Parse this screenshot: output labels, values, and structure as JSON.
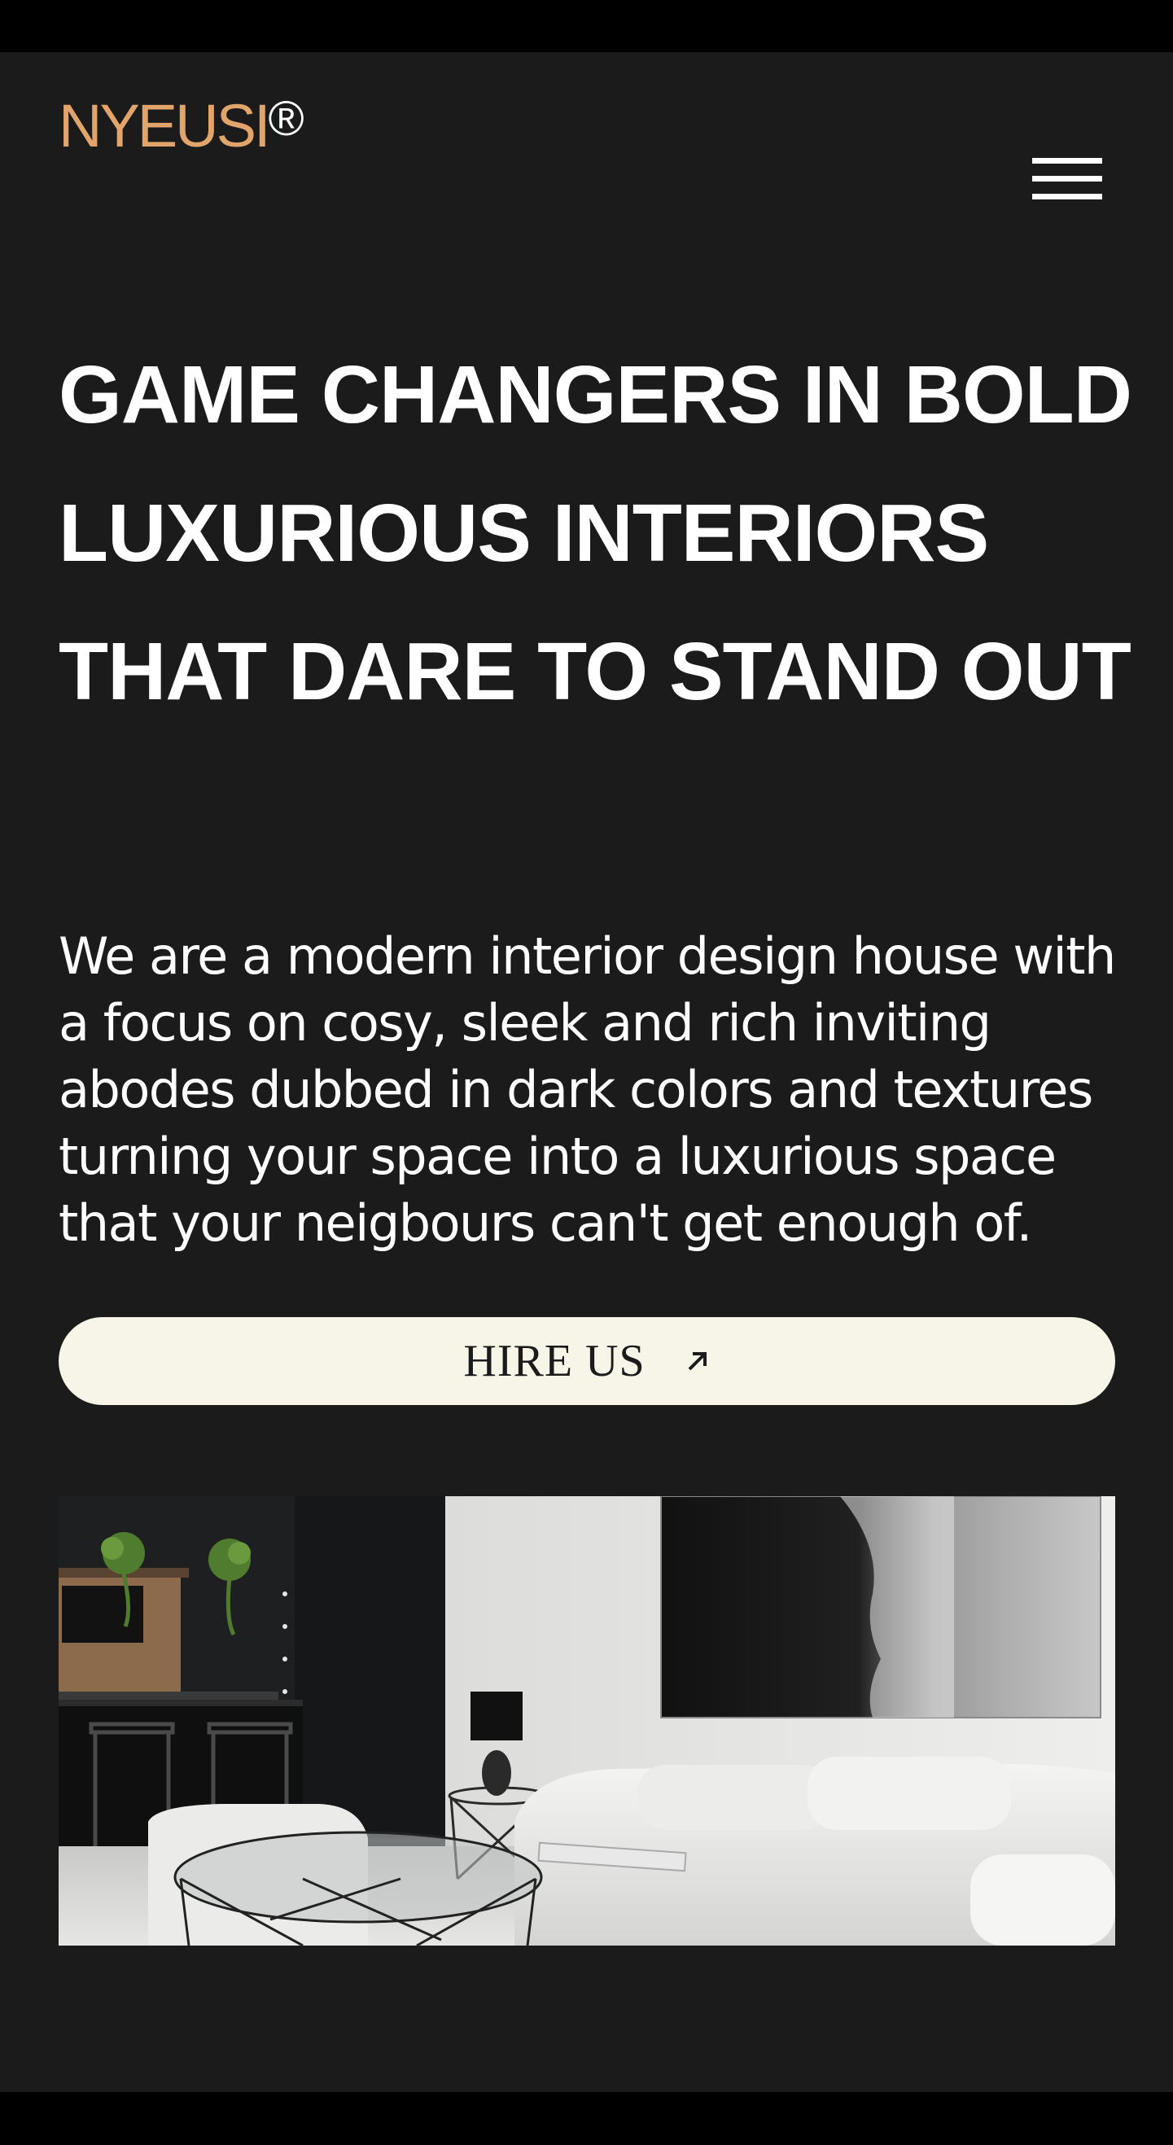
{
  "header": {
    "logo_text": "NYEUSI",
    "logo_mark": "®",
    "menu_icon": "hamburger-menu-icon"
  },
  "hero": {
    "headline": "GAME CHANGERS IN BOLD LUXURIOUS INTERIORS THAT DARE TO STAND OUT",
    "intro": "We are a modern interior design house with a focus on cosy, sleek and rich inviting abodes dubbed in dark colors and textures turning your space into a luxurious space that your neigbours can't get enough of.",
    "cta_label": "HIRE US",
    "cta_icon": "arrow-up-right-icon"
  },
  "colors": {
    "background": "#1b1b1b",
    "outer_frame": "#000000",
    "brand": "#e1a56b",
    "text": "#ffffff",
    "button_bg": "#f7f5e8",
    "button_text": "#1b1b1b"
  }
}
